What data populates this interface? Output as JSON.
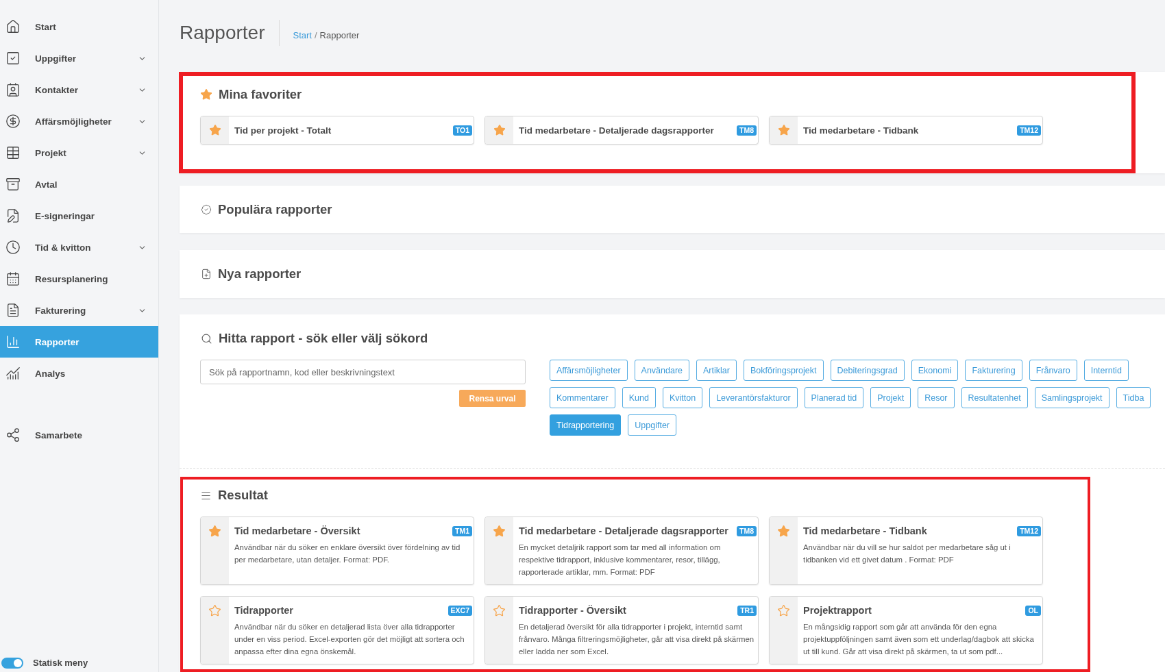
{
  "sidebar": {
    "sections": [
      {
        "items": [
          {
            "label": "Start",
            "has_submenu": false,
            "selected": false
          },
          {
            "label": "Uppgifter",
            "has_submenu": true,
            "selected": false
          },
          {
            "label": "Kontakter",
            "has_submenu": true,
            "selected": false
          },
          {
            "label": "Affärsmöjligheter",
            "has_submenu": true,
            "selected": false
          },
          {
            "label": "Projekt",
            "has_submenu": true,
            "selected": false
          },
          {
            "label": "Avtal",
            "has_submenu": false,
            "selected": false
          },
          {
            "label": "E-signeringar",
            "has_submenu": false,
            "selected": false
          },
          {
            "label": "Tid & kvitton",
            "has_submenu": true,
            "selected": false
          },
          {
            "label": "Resursplanering",
            "has_submenu": false,
            "selected": false
          },
          {
            "label": "Fakturering",
            "has_submenu": true,
            "selected": false
          },
          {
            "label": "Rapporter",
            "has_submenu": false,
            "selected": true
          },
          {
            "label": "Analys",
            "has_submenu": false,
            "selected": false
          }
        ]
      },
      {
        "items": [
          {
            "label": "Samarbete",
            "has_submenu": false,
            "selected": false
          }
        ]
      }
    ],
    "footer": {
      "label": "Statisk meny",
      "on": true
    }
  },
  "header": {
    "title": "Rapporter",
    "breadcrumb": {
      "separator": "/",
      "items": [
        {
          "label": "Start",
          "link": true
        },
        {
          "label": "Rapporter",
          "link": false
        }
      ]
    }
  },
  "favorites": {
    "title": "Mina favoriter",
    "highlighted": true,
    "items": [
      {
        "title": "Tid per projekt - Totalt",
        "code": "TO1",
        "favorite": true
      },
      {
        "title": "Tid medarbetare - Detaljerade dagsrapporter",
        "code": "TM8",
        "favorite": true
      },
      {
        "title": "Tid medarbetare - Tidbank",
        "code": "TM12",
        "favorite": true
      }
    ]
  },
  "popular": {
    "title": "Populära rapporter"
  },
  "new_reports": {
    "title": "Nya rapporter"
  },
  "search": {
    "title": "Hitta rapport - sök eller välj sökord",
    "placeholder": "Sök på rapportnamn, kod eller beskrivningstext",
    "clear_button": "Rensa urval",
    "tag_rows": [
      [
        {
          "label": "Affärsmöjligheter",
          "selected": false
        },
        {
          "label": "Användare",
          "selected": false
        },
        {
          "label": "Artiklar",
          "selected": false
        },
        {
          "label": "Bokföringsprojekt",
          "selected": false
        },
        {
          "label": "Debiteringsgrad",
          "selected": false
        },
        {
          "label": "Ekonomi",
          "selected": false
        },
        {
          "label": "Fakturering",
          "selected": false
        },
        {
          "label": "Frånvaro",
          "selected": false
        },
        {
          "label": "Interntid",
          "selected": false
        }
      ],
      [
        {
          "label": "Kommentarer",
          "selected": false
        },
        {
          "label": "Kund",
          "selected": false
        },
        {
          "label": "Kvitton",
          "selected": false
        },
        {
          "label": "Leverantörsfakturor",
          "selected": false
        },
        {
          "label": "Planerad tid",
          "selected": false
        },
        {
          "label": "Projekt",
          "selected": false
        },
        {
          "label": "Resor",
          "selected": false
        },
        {
          "label": "Resultatenhet",
          "selected": false
        },
        {
          "label": "Samlingsprojekt",
          "selected": false
        },
        {
          "label": "Tidba",
          "selected": false
        }
      ],
      [
        {
          "label": "Tidrapportering",
          "selected": true
        },
        {
          "label": "Uppgifter",
          "selected": false
        }
      ]
    ]
  },
  "results": {
    "title": "Resultat",
    "highlighted": true,
    "cards": [
      {
        "title": "Tid medarbetare - Översikt",
        "code": "TM1",
        "favorite": true,
        "description": "Användbar när du söker en enklare översikt över fördelning av tid per medarbetare, utan detaljer. Format: PDF."
      },
      {
        "title": "Tid medarbetare - Detaljerade dagsrapporter",
        "code": "TM8",
        "favorite": true,
        "description": "En mycket detaljrik rapport som tar med all information om respektive tidrapport, inklusive kommentarer, resor, tillägg, rapporterade artiklar, mm. Format: PDF"
      },
      {
        "title": "Tid medarbetare - Tidbank",
        "code": "TM12",
        "favorite": true,
        "description": "Användbar när du vill se hur saldot per medarbetare såg ut i tidbanken vid ett givet datum . Format: PDF"
      },
      {
        "title": "Tidrapporter",
        "code": "EXC7",
        "favorite": false,
        "description": "Användbar när du söker en detaljerad lista över alla tidrapporter under en viss period. Excel-exporten gör det möjligt att sortera och anpassa efter dina egna önskemål."
      },
      {
        "title": "Tidrapporter - Översikt",
        "code": "TR1",
        "favorite": false,
        "description": "En detaljerad översikt för alla tidrapporter i projekt, interntid samt frånvaro. Många filtreringsmöjligheter, går att visa direkt på skärmen eller ladda ner som Excel."
      },
      {
        "title": "Projektrapport",
        "code": "OL",
        "favorite": false,
        "description": "En mångsidig rapport som går att använda för den egna projektuppföljningen samt även som ett underlag/dagbok att skicka ut till kund. Går att visa direkt på skärmen, ta ut som pdf..."
      }
    ]
  }
}
